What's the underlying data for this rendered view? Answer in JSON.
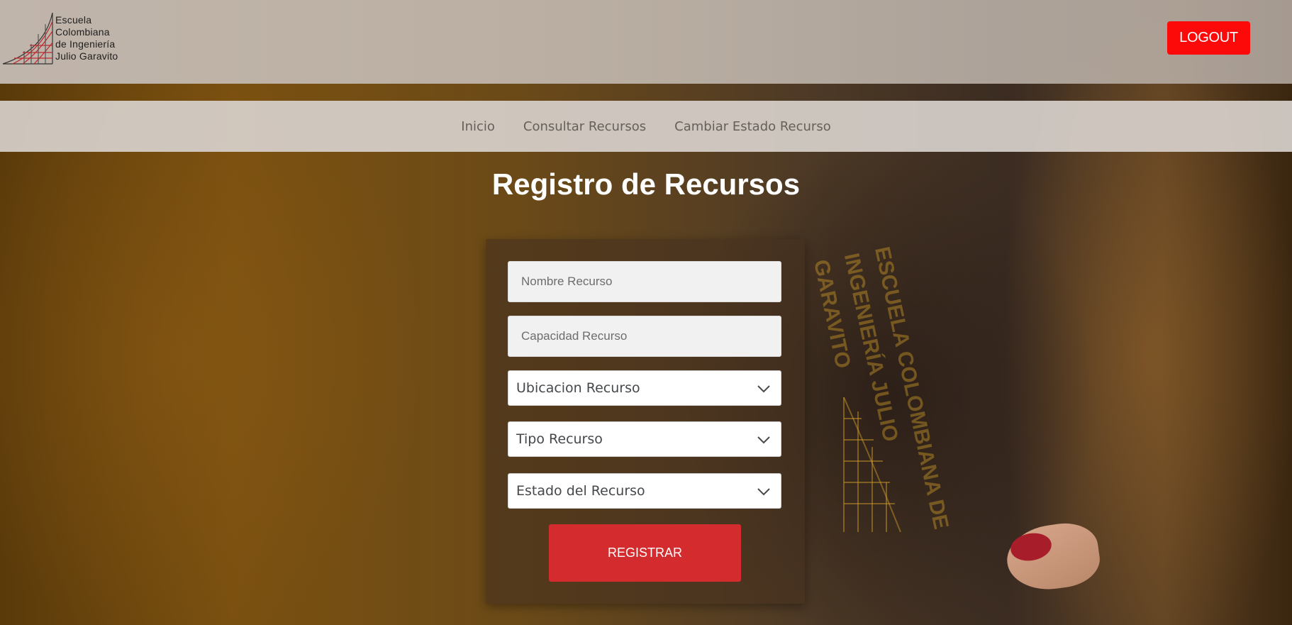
{
  "header": {
    "logo_lines": [
      "Escuela",
      "Colombiana",
      "de Ingeniería",
      "Julio Garavito"
    ],
    "logout_label": "LOGOUT"
  },
  "nav": {
    "items": [
      {
        "label": "Inicio"
      },
      {
        "label": "Consultar Recursos"
      },
      {
        "label": "Cambiar Estado Recurso"
      }
    ]
  },
  "main": {
    "title": "Registro de Recursos",
    "form": {
      "name_placeholder": "Nombre Recurso",
      "capacity_placeholder": "Capacidad Recurso",
      "location_select": "Ubicacion Recurso",
      "type_select": "Tipo Recurso",
      "state_select": "Estado del Recurso",
      "submit_label": "REGISTRAR"
    }
  },
  "colors": {
    "logout_bg": "#fc0a0a",
    "register_bg": "#d42c2e",
    "logo_red": "#c0282d"
  },
  "icons": {
    "select_arrow": "chevron-down-icon",
    "logo": "eci-logo"
  }
}
